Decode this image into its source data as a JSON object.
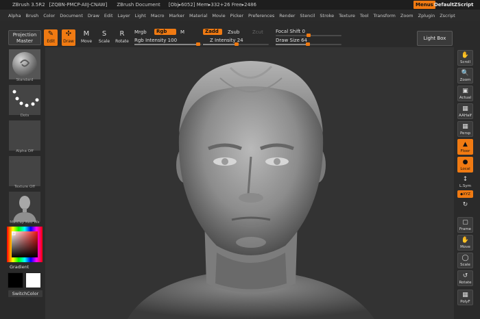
{
  "titlebar": {
    "app": "ZBrush 3.5R2",
    "serial": "[ZQBN-PMCP-AIIJ-CNAW]",
    "document": "ZBrush Document",
    "mem": "[Obj▸6052] Mem▸332+26 Free▸2486",
    "menus": "Menus",
    "script": "DefaultZScript"
  },
  "menubar": [
    "Alpha",
    "Brush",
    "Color",
    "Document",
    "Draw",
    "Edit",
    "Layer",
    "Light",
    "Macro",
    "Marker",
    "Material",
    "Movie",
    "Picker",
    "Preferences",
    "Render",
    "Stencil",
    "Stroke",
    "Texture",
    "Tool",
    "Transform",
    "Zoom",
    "Zplugin",
    "Zscript"
  ],
  "shelf": {
    "projection": "Projection Master",
    "edit": "Edit",
    "draw": "Draw",
    "move": "Move",
    "scale": "Scale",
    "rotate": "Rotate",
    "mrgb": "Mrgb",
    "rgb": "Rgb",
    "m": "M",
    "zadd": "Zadd",
    "zsub": "Zsub",
    "zcut": "Zcut",
    "rgb_intensity": "Rgb Intensity 100",
    "z_intensity": "Z Intensity 24",
    "focal_shift": "Focal Shift 0",
    "draw_size": "Draw Size 64",
    "lightbox": "Light Box"
  },
  "left": {
    "standard": "Standard",
    "dots": "Dots",
    "alpha": "Alpha Off",
    "texture": "Texture Off",
    "matcap": "MatCap Red Wa",
    "gradient": "Gradient",
    "switch": "SwitchColor"
  },
  "right": {
    "scroll": "Scroll",
    "zoom": "Zoom",
    "actual": "Actual",
    "aahalf": "AAHalf",
    "persp": "Persp",
    "floor": "Floor",
    "local": "Local",
    "lsym": "L.Sym",
    "xyz": "◆XYZ",
    "frame": "Frame",
    "move": "Move",
    "scale": "Scale",
    "rotate": "Rotate",
    "polyf": "PolyF"
  },
  "colors": {
    "accent": "#f07a12",
    "panel": "#2a2a2a",
    "canvas": "#333333"
  }
}
